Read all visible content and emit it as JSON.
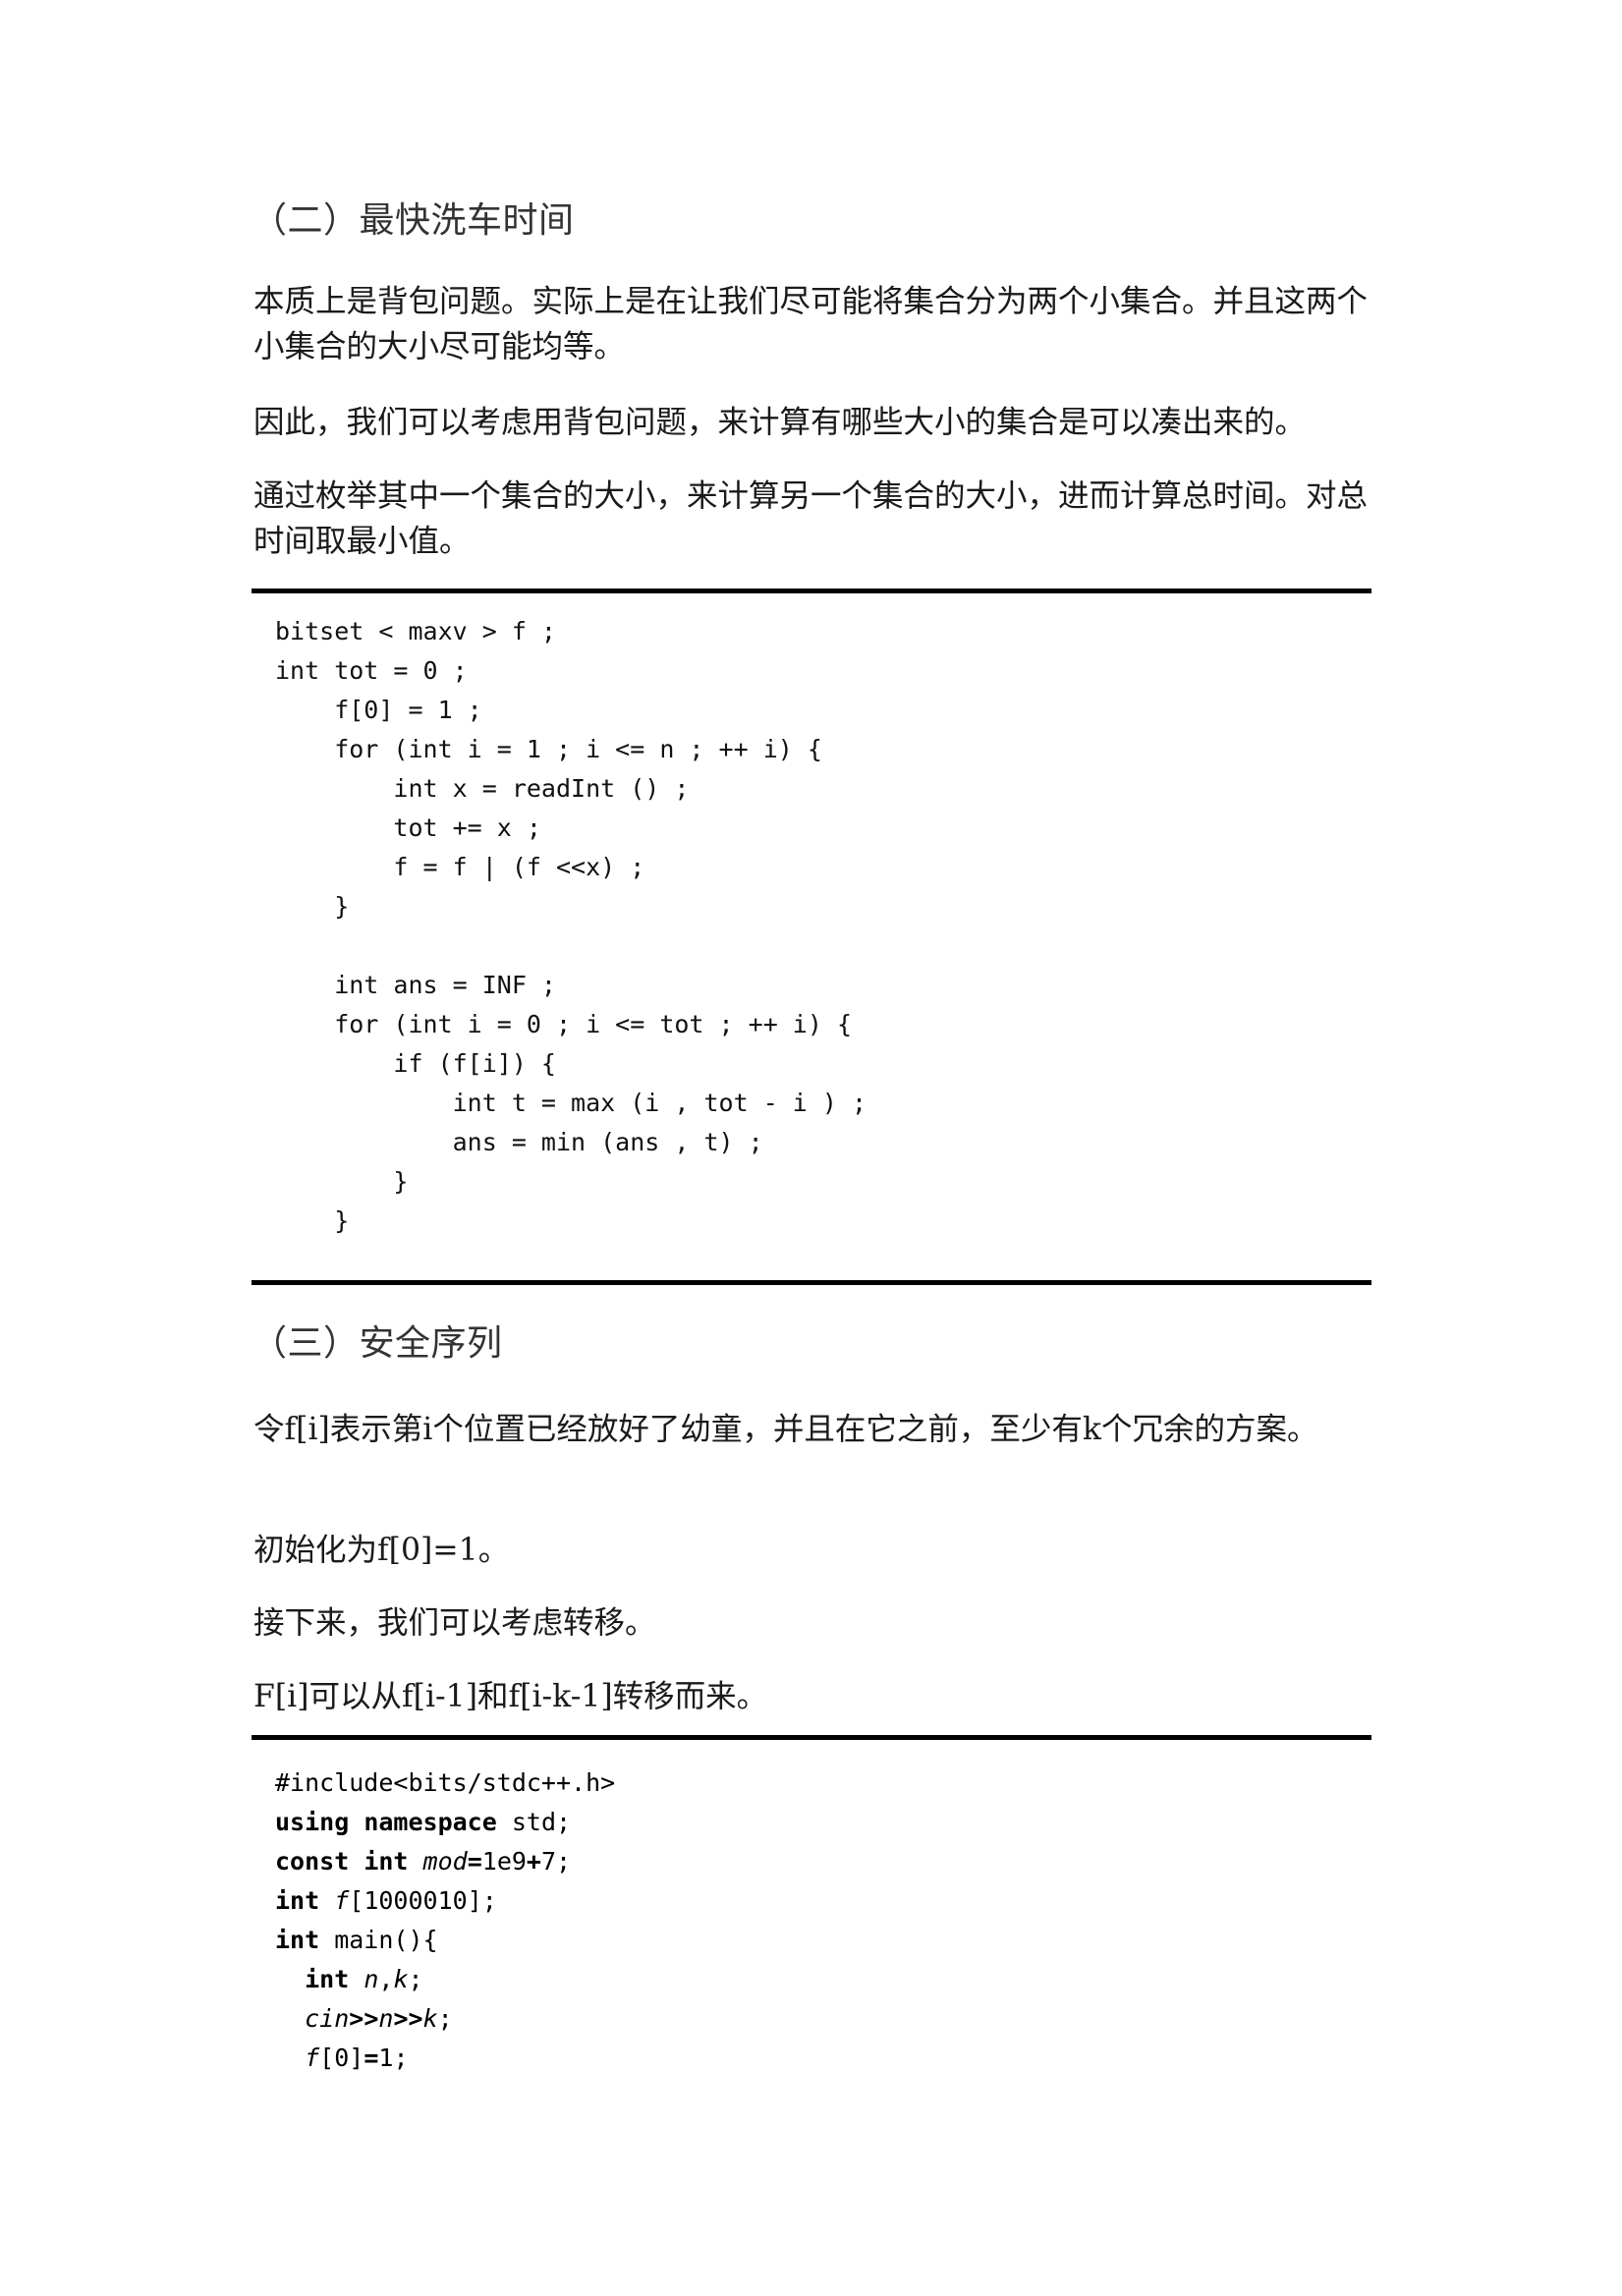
{
  "section2": {
    "title": "（二）最快洗车时间",
    "paragraphs": [
      "本质上是背包问题。实际上是在让我们尽可能将集合分为两个小集合。并且这两个小集合的大小尽可能均等。",
      "因此，我们可以考虑用背包问题，来计算有哪些大小的集合是可以凑出来的。",
      "通过枚举其中一个集合的大小，来计算另一个集合的大小，进而计算总时间。对总时间取最小值。"
    ],
    "code_lines": [
      "bitset < maxv > f ;",
      "int tot = 0 ;",
      "    f[0] = 1 ;",
      "    for (int i = 1 ; i <= n ; ++ i) {",
      "        int x = readInt () ;",
      "        tot += x ;",
      "        f = f | (f <<x) ;",
      "    }",
      "",
      "    int ans = INF ;",
      "    for (int i = 0 ; i <= tot ; ++ i) {",
      "        if (f[i]) {",
      "            int t = max (i , tot - i ) ;",
      "            ans = min (ans , t) ;",
      "        }",
      "    }"
    ]
  },
  "section3": {
    "title": "（三）安全序列",
    "paragraphs": [
      "令f[i]表示第i个位置已经放好了幼童，并且在它之前，至少有k个冗余的方案。",
      "初始化为f[0]=1。",
      "接下来，我们可以考虑转移。",
      "F[i]可以从f[i-1]和f[i-k-1]转移而来。"
    ],
    "code_lines": {
      "l0": {
        "a": "#include<bits/stdc++.h>"
      },
      "l1": {
        "kw1": "using",
        "sp1": " ",
        "kw2": "namespace",
        "rest": " std;"
      },
      "l2": {
        "kw1": "const",
        "sp1": " ",
        "kw2": "int",
        "sp2": " ",
        "it1": "mod",
        "op1": "=",
        "n1": "1e9",
        "op2": "+",
        "n2": "7;"
      },
      "l3": {
        "kw1": "int",
        "sp1": " ",
        "it1": "f",
        "rest": "[1000010];"
      },
      "l4": {
        "kw1": "int",
        "rest": " main(){"
      },
      "l5": {
        "ind": "  ",
        "kw1": "int",
        "sp1": " ",
        "it1": "n",
        "c": ",",
        "it2": "k",
        "rest": ";"
      },
      "l6": {
        "ind": "  ",
        "it1": "cin",
        "op1": ">>",
        "it2": "n",
        "op2": ">>",
        "it3": "k",
        "rest": ";"
      },
      "l7": {
        "ind": "  ",
        "it1": "f",
        "rest": "[0]",
        "op1": "=",
        "n1": "1;"
      }
    }
  }
}
